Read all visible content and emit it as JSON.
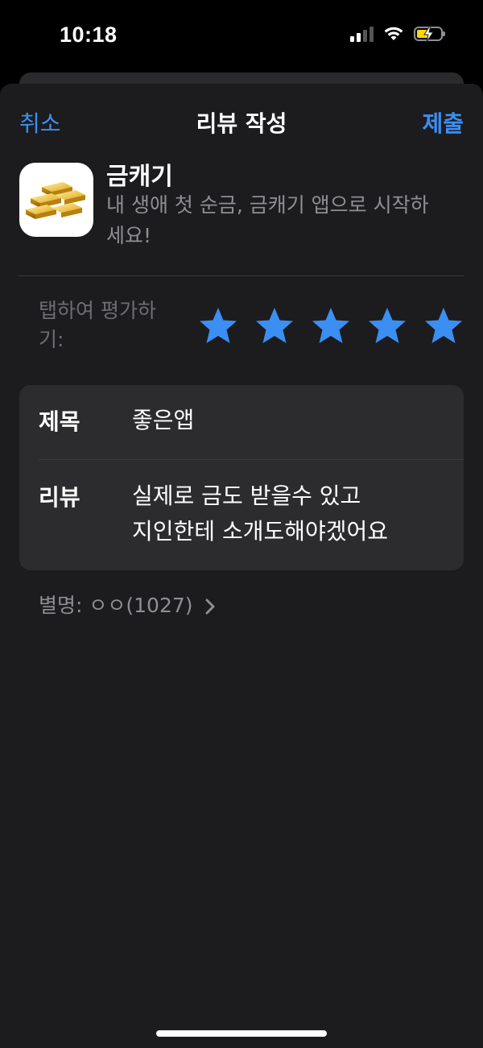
{
  "status_bar": {
    "time": "10:18"
  },
  "nav": {
    "cancel_label": "취소",
    "title": "리뷰 작성",
    "submit_label": "제출"
  },
  "app": {
    "name": "금캐기",
    "subtitle": "내 생애 첫 순금, 금캐기 앱으로 시작하세요!",
    "icon": "gold-bars-icon"
  },
  "rating": {
    "label": "탭하여 평가하기:",
    "value": 5,
    "max": 5,
    "star_color": "#3b8ff3"
  },
  "form": {
    "title_label": "제목",
    "title_value": "좋은앱",
    "review_label": "리뷰",
    "review_line1": "실제로 금도 받을수 있고",
    "review_line2": "지인한테 소개도해야겠어요"
  },
  "nickname": {
    "label": "별명:",
    "value": "ㅇㅇ(1027)"
  },
  "colors": {
    "accent": "#3b8ff3",
    "sheet_bg": "#1c1c1e",
    "card_bg": "#2c2c2e"
  }
}
